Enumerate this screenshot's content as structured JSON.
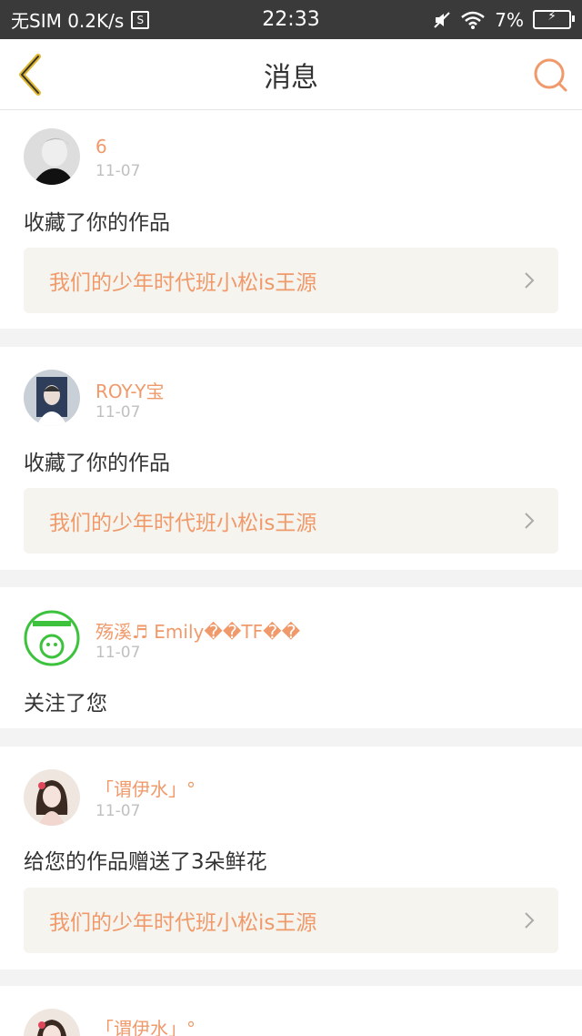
{
  "status_bar": {
    "left": "无SIM 0.2K/s",
    "s_badge": "S",
    "time": "22:33",
    "battery": "7%",
    "icons": [
      "mute-icon",
      "wifi-icon",
      "battery-charging-icon"
    ]
  },
  "header": {
    "title": "消息",
    "back_icon": "chevron-left-icon",
    "search_icon": "search-icon"
  },
  "colors": {
    "accent": "#f09a6b",
    "back_icon": "#e0b62f",
    "card_bg": "#f5f4ee",
    "page_bg": "#f3f3f3"
  },
  "messages": [
    {
      "user": "6",
      "date": "11-07",
      "action": "收藏了你的作品",
      "work": "我们的少年时代班小松is王源"
    },
    {
      "user": "ROY-Y宝",
      "date": "11-07",
      "action": "收藏了你的作品",
      "work": "我们的少年时代班小松is王源"
    },
    {
      "user": "殇溪♬ Emily��TF��",
      "date": "11-07",
      "action": "关注了您"
    },
    {
      "user": "「谓伊水」°",
      "date": "11-07",
      "action": "给您的作品赠送了3朵鲜花",
      "work": "我们的少年时代班小松is王源"
    },
    {
      "user": "「谓伊水」°"
    }
  ]
}
